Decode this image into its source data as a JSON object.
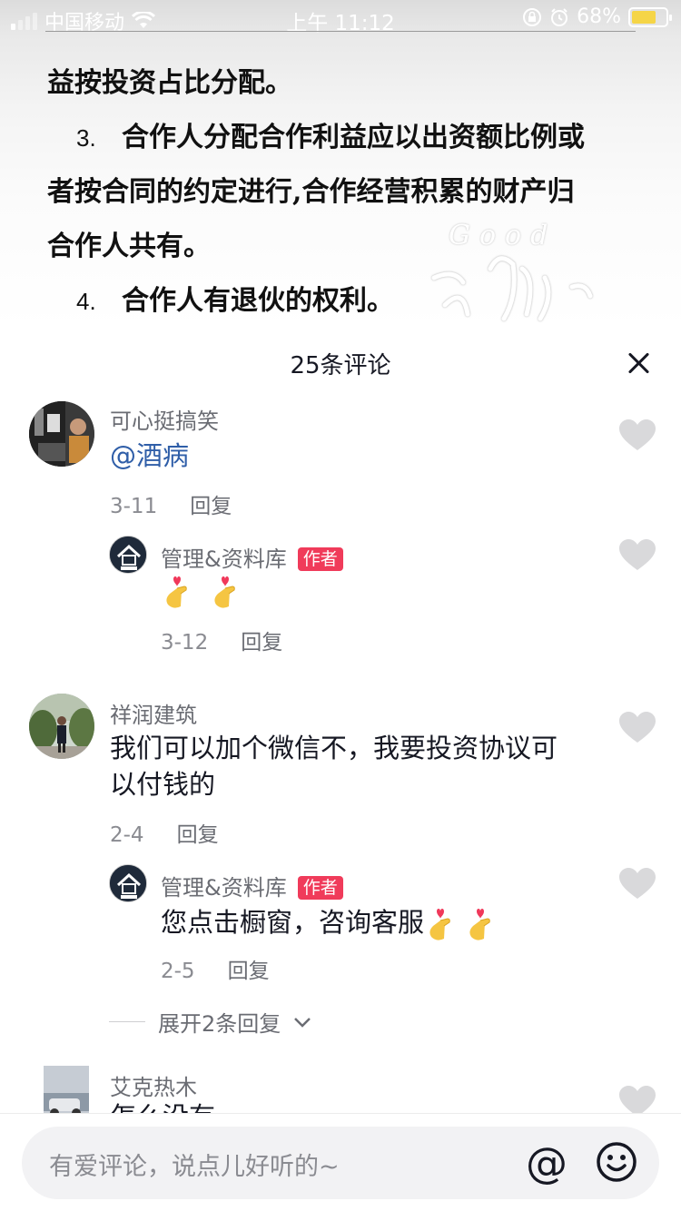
{
  "status_bar": {
    "carrier": "中国移动",
    "time": "上午 11:12",
    "battery": "68%"
  },
  "document": {
    "line1": "益按投资占比分配。",
    "item3_num": "3.",
    "item3_line1": "合作人分配合作利益应以出资额比例或",
    "item3_line2": "者按合同的约定进行,合作经营积累的财产归",
    "item3_line3": "合作人共有。",
    "item4_num": "4.",
    "item4_text": "合作人有退伙的权利。",
    "watermark_text": "Good"
  },
  "comments_sheet": {
    "title": "25条评论"
  },
  "comments": [
    {
      "user": "可心挺搞笑",
      "text": "@酒病",
      "date": "3-11",
      "reply_label": "回复"
    },
    {
      "user": "管理&资料库",
      "tag": "作者",
      "date": "3-12",
      "reply_label": "回复",
      "emoji": "finger-heart"
    },
    {
      "user": "祥润建筑",
      "text_line1": "我们可以加个微信不，我要投资协议可",
      "text_line2": "以付钱的",
      "date": "2-4",
      "reply_label": "回复"
    },
    {
      "user": "管理&资料库",
      "tag": "作者",
      "text": "您点击橱窗，咨询客服",
      "date": "2-5",
      "reply_label": "回复"
    },
    {
      "user": "艾克热木",
      "text": "怎么没有"
    }
  ],
  "expand_replies": "展开2条回复",
  "input": {
    "placeholder": "有爱评论，说点儿好听的~",
    "at_symbol": "@"
  },
  "colors": {
    "author_tag": "#f03b5a",
    "mention": "#2f5ea8"
  }
}
